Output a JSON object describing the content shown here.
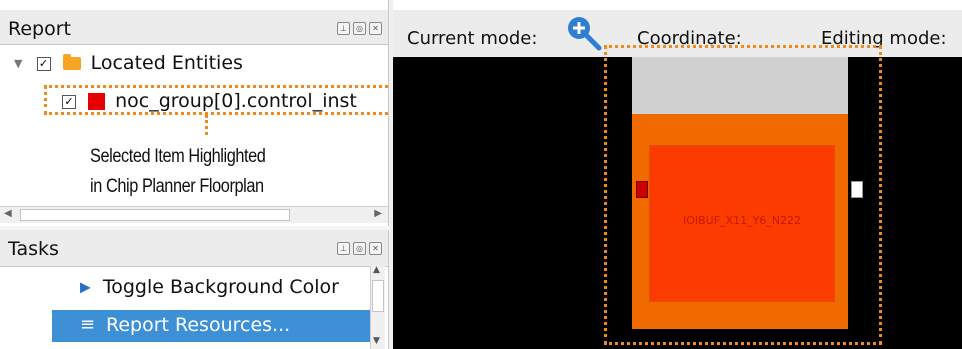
{
  "report": {
    "title": "Report",
    "tree": {
      "root_label": "Located Entities",
      "child_label": "noc_group[0].control_inst"
    },
    "annotation": {
      "line1": "Selected Item Highlighted",
      "line2": "in Chip Planner Floorplan"
    }
  },
  "tasks": {
    "title": "Tasks",
    "items": [
      {
        "label": "Toggle Background Color",
        "icon": "play-triangle-icon"
      },
      {
        "label": "Report Resources...",
        "icon": "list-icon"
      }
    ]
  },
  "toolbar": {
    "current_mode_label": "Current mode:",
    "coordinate_label": "Coordinate:",
    "editing_mode_label": "Editing mode:"
  },
  "floorplan": {
    "cell_label": "IOIBUF_X11_Y6_N222"
  },
  "colors": {
    "orange_block": "#f06a00",
    "red_block": "#fb3b00",
    "highlight_dash": "#f08a1c",
    "selection_blue": "#3d8fd6"
  }
}
